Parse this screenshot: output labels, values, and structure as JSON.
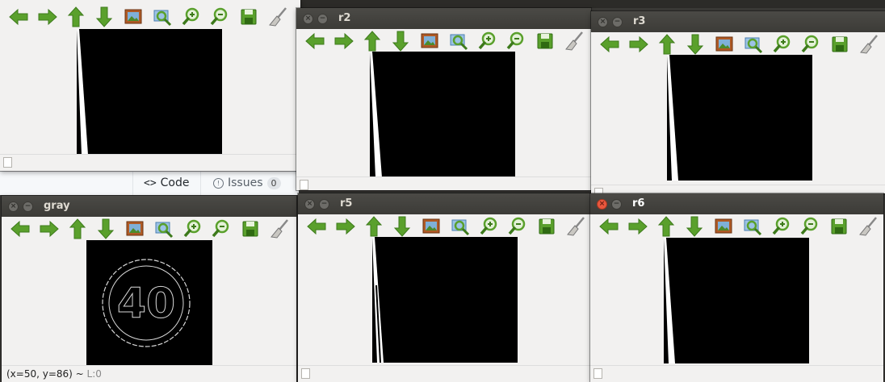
{
  "github_tabs": {
    "code_label": "Code",
    "issues_label": "Issues",
    "issues_count": "0"
  },
  "windows": [
    {
      "id": "w0",
      "title": ""
    },
    {
      "id": "r2",
      "title": "r2"
    },
    {
      "id": "r3",
      "title": "r3"
    },
    {
      "id": "gray",
      "title": "gray"
    },
    {
      "id": "r5",
      "title": "r5"
    },
    {
      "id": "r6",
      "title": "r6"
    }
  ],
  "toolbar_icons": [
    "arrow-left-icon",
    "arrow-right-icon",
    "arrow-up-icon",
    "arrow-down-icon",
    "image-icon",
    "zoom-fit-icon",
    "zoom-in-icon",
    "zoom-out-icon",
    "save-icon",
    "brush-icon"
  ],
  "gray_status": {
    "coords": "(x=50, y=86) ~ ",
    "level": "L:0"
  },
  "gray_image_text": "40",
  "colors": {
    "arrow_green": "#5aa02c",
    "titlebar": "#3c3b37",
    "close_active": "#e9573e",
    "window_bg": "#f2f1f0"
  }
}
